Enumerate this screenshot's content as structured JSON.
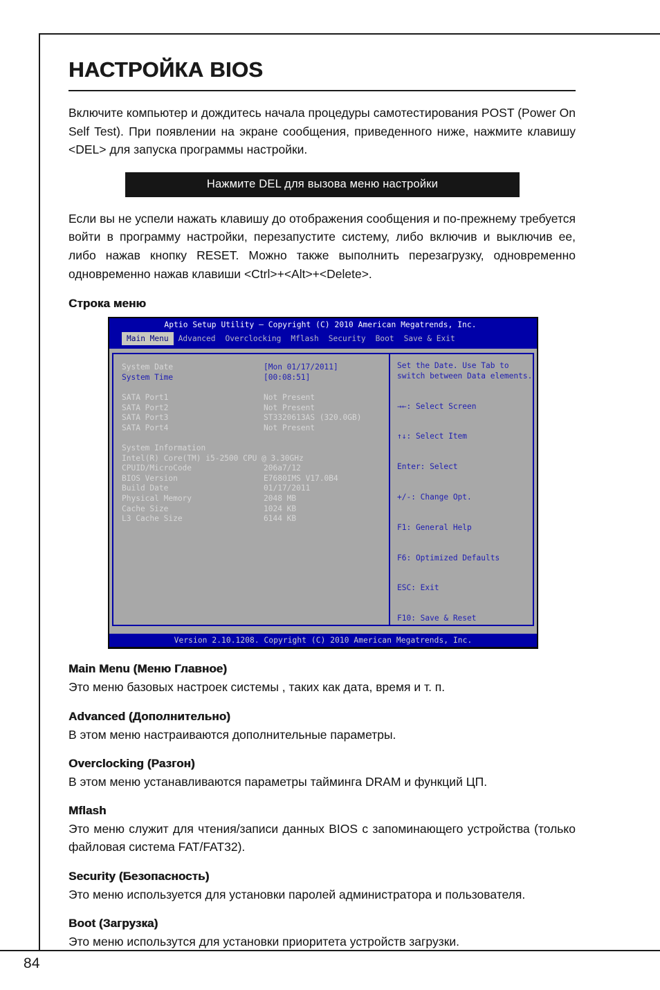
{
  "page": {
    "number": "84",
    "title": "НАСТРОЙКА BIOS"
  },
  "intro": {
    "paragraph": "Включите компьютер и дождитесь начала процедуры самотестирования POST (Power On Self Test). При появлении на экране сообщения, приведенного ниже, нажмите клавишу <DEL> для запуска программы настройки."
  },
  "del_banner": {
    "text": "Нажмите DEL для вызова меню настройки"
  },
  "second_paragraph": {
    "text": "Если вы не успели нажать клавишу до отображения сообщения и по-прежнему требуется войти в программу настройки, перезапустите систему, либо включив и выключив ее, либо нажав кнопку RESET. Можно также выполнить перезагрузку, одновременно одновременно нажав клавиши <Ctrl>+<Alt>+<Delete>."
  },
  "menubar_heading": "Строка меню",
  "bios": {
    "titlebar": "Aptio Setup Utility – Copyright (C) 2010 American Megatrends, Inc.",
    "tabs": [
      {
        "label": "Main Menu",
        "active": true
      },
      {
        "label": "Advanced",
        "active": false
      },
      {
        "label": "Overclocking",
        "active": false
      },
      {
        "label": "Mflash",
        "active": false
      },
      {
        "label": "Security",
        "active": false
      },
      {
        "label": "Boot",
        "active": false
      },
      {
        "label": "Save & Exit",
        "active": false
      }
    ],
    "settings": [
      {
        "label": "System Date",
        "value": "[Mon 01/17/2011]",
        "style": "blue"
      },
      {
        "label": "System Time",
        "value": "[00:08:51]",
        "style": "blue"
      }
    ],
    "sata": [
      {
        "label": "SATA Port1",
        "value": "Not Present"
      },
      {
        "label": "SATA Port2",
        "value": "Not Present"
      },
      {
        "label": "SATA Port3",
        "value": "ST3320613AS (320.0GB)"
      },
      {
        "label": "SATA Port4",
        "value": "Not Present"
      }
    ],
    "system_information": {
      "heading": "System Information",
      "cpu": "Intel(R) Core(TM) i5-2500 CPU @ 3.30GHz",
      "rows": [
        {
          "label": "CPUID/MicroCode",
          "value": "206a7/12"
        },
        {
          "label": "BIOS Version",
          "value": "E7680IMS V17.0B4"
        },
        {
          "label": "Build Date",
          "value": "01/17/2011"
        },
        {
          "label": "Physical Memory",
          "value": "2048 MB"
        },
        {
          "label": "Cache Size",
          "value": "1024 KB"
        },
        {
          "label": "L3 Cache Size",
          "value": "6144 KB"
        }
      ]
    },
    "help": {
      "line1": "Set the Date. Use Tab to",
      "line2": "switch between Data elements."
    },
    "keys": [
      "→←: Select Screen",
      "↑↓: Select Item",
      "Enter: Select",
      "+/-: Change Opt.",
      "F1: General Help",
      "F6: Optimized Defaults",
      "ESC: Exit",
      "F10: Save & Reset"
    ],
    "footer": "Version 2.10.1208. Copyright (C) 2010 American Megatrends, Inc."
  },
  "sections": [
    {
      "heading": "Main Menu (Меню Главное)",
      "body": "Это меню базовых настроек системы , таких как дата, время и т. п."
    },
    {
      "heading": "Advanced (Дополнительно)",
      "body": "В этом меню настраиваются дополнительные параметры."
    },
    {
      "heading": "Overclocking (Разгон)",
      "body": "В этом меню устанавливаются параметры тайминга DRAM и функций ЦП."
    },
    {
      "heading": "Mflash",
      "body": "Это меню служит для чтения/записи данных BIOS с запоминающего устройства (только файловая система FAT/FAT32)."
    },
    {
      "heading": "Security (Безопасность)",
      "body": "Это меню используется для установки паролей администратора и пользователя."
    },
    {
      "heading": "Boot (Загрузка)",
      "body": "Это меню использутся для установки приоритета устройств загрузки."
    }
  ]
}
